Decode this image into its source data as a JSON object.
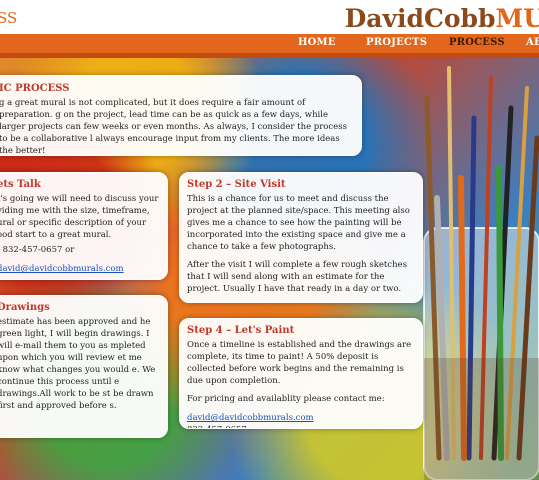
{
  "brand": {
    "left_partial": "SS",
    "right_a": "DavidCobb",
    "right_b": "MU"
  },
  "nav": {
    "home": "HOME",
    "projects": "PROJECTS",
    "process": "PROCESS",
    "about_partial": "AB"
  },
  "intro": {
    "title": "IC PROCESS",
    "text": "g a great mural is not complicated, but it does require a fair amount of preparation. g on the project, lead time can be as quick as a few days, while larger projects can few weeks or even months.  As always, I consider the process to be a collaborative l always encourage input from my clients. The more ideas the better!"
  },
  "step1": {
    "title": "ets Talk",
    "text": "t's going we will need to discuss your viding me with the size, timeframe, ural or specific  description of your ood start to a great mural.",
    "phone": "- 832-457-0657 or",
    "email": "david@davidcobbmurals.com"
  },
  "step2": {
    "title": "Step 2 – Site Visit",
    "text1": "This is a chance for us to meet and discuss the project at the planned site/space.  This  meeting also gives me a chance to see how  the painting will be incorporated into the existing space and give me a chance to take a few photographs.",
    "text2": "After the visit I will complete a few rough sketches that I will send along with an estimate for the project. Usually I have that ready in a day or two."
  },
  "step3": {
    "title": "Drawings",
    "text": "estimate has been approved and he green light, I will begin drawings. I will e-mail them to you as mpleted upon which you will review et me know what changes you would e. We continue this process until e drawings.All work to be st be drawn first and approved before s."
  },
  "step4": {
    "title": "Step 4 – Let's Paint",
    "text1": "Once a timeline is established and the drawings are complete, its time to paint! A 50% deposit is collected before work begins and the remaining is due upon completion.",
    "text2": "For pricing and availablity please contact me:",
    "email": "david@davidcobbmurals.com",
    "phone": "832-457-0657"
  }
}
